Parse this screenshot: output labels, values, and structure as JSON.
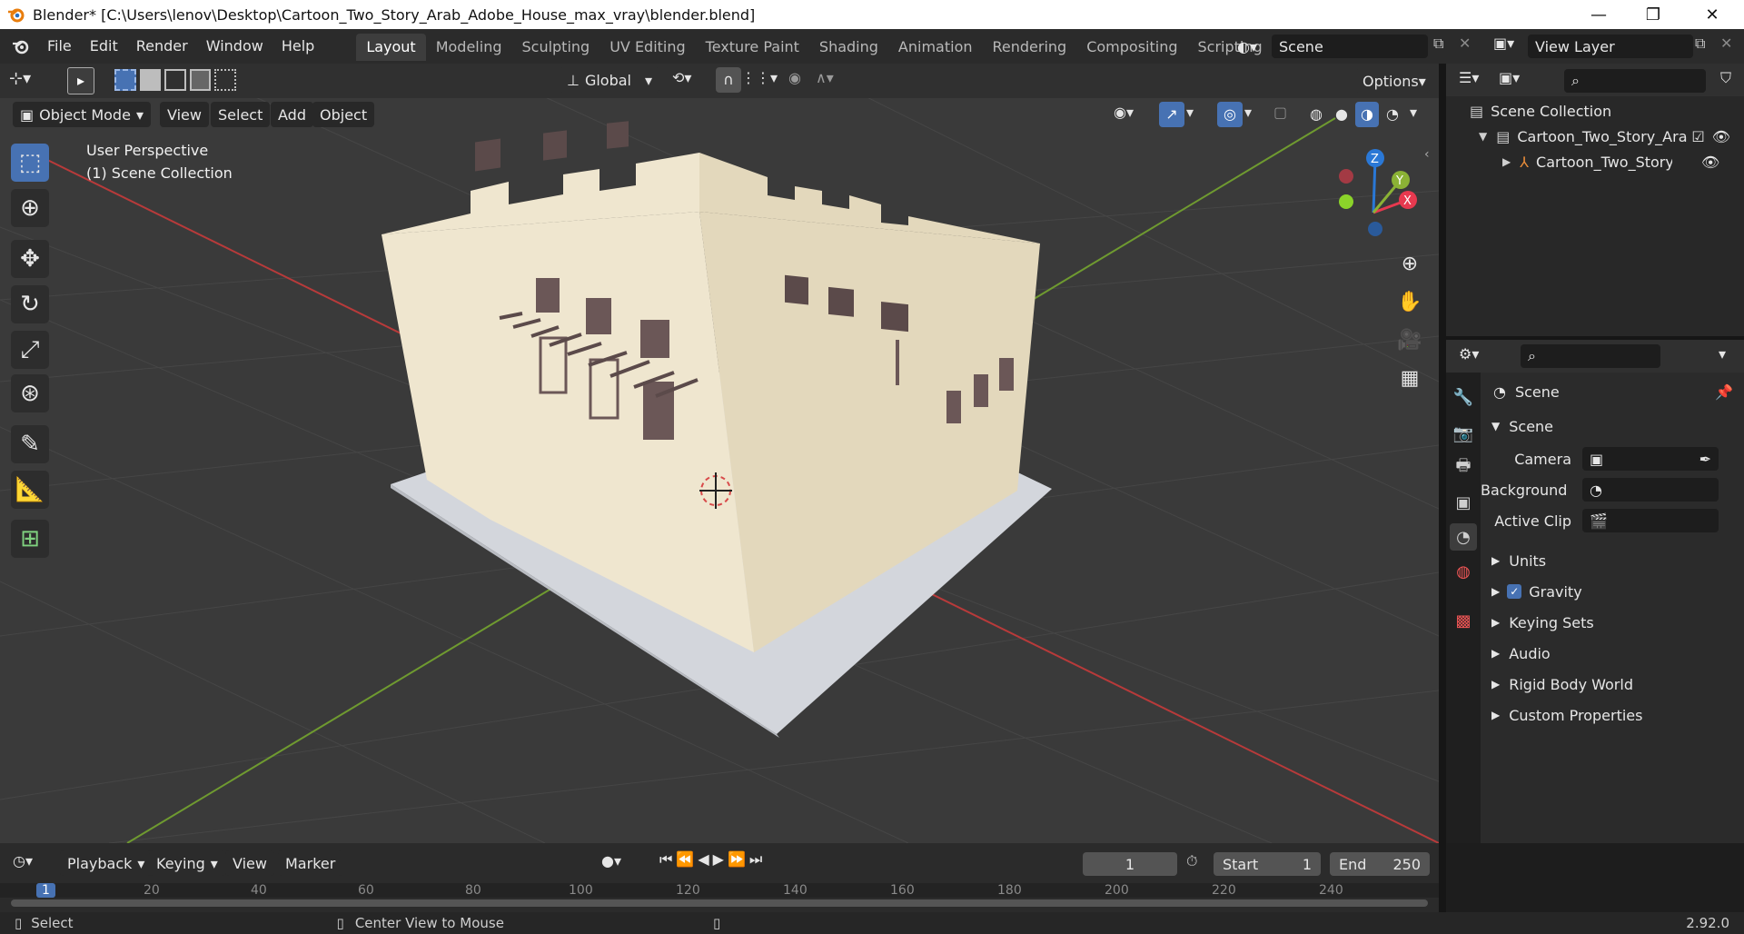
{
  "titlebar": {
    "title": "Blender* [C:\\Users\\lenov\\Desktop\\Cartoon_Two_Story_Arab_Adobe_House_max_vray\\blender.blend]",
    "minimize": "—",
    "maximize": "❐",
    "close": "✕"
  },
  "menu": {
    "items": [
      "File",
      "Edit",
      "Render",
      "Window",
      "Help"
    ]
  },
  "workspaces": {
    "tabs": [
      "Layout",
      "Modeling",
      "Sculpting",
      "UV Editing",
      "Texture Paint",
      "Shading",
      "Animation",
      "Rendering",
      "Compositing",
      "Scripting"
    ],
    "add_label": "+"
  },
  "scene_selector": {
    "value": "Scene"
  },
  "view_layer_selector": {
    "value": "View Layer"
  },
  "viewport_header": {
    "transform_orientation": "Global",
    "options_label": "Options",
    "mode": "Object Mode",
    "menus": [
      "View",
      "Select",
      "Add",
      "Object"
    ]
  },
  "viewport": {
    "perspective_label": "User Perspective",
    "collection_label": "(1) Scene Collection",
    "gizmo": {
      "x": "X",
      "y": "Y",
      "z": "Z"
    }
  },
  "outliner": {
    "rows": [
      {
        "label": "Scene Collection"
      },
      {
        "label": "Cartoon_Two_Story_Arab"
      },
      {
        "label": "Cartoon_Two_Story_/"
      }
    ]
  },
  "properties": {
    "context_label": "Scene",
    "panel_title": "Scene",
    "camera_label": "Camera",
    "background_label": "Background ...",
    "active_clip_label": "Active Clip",
    "sections": [
      "Units",
      "Gravity",
      "Keying Sets",
      "Audio",
      "Rigid Body World",
      "Custom Properties"
    ],
    "gravity_checked": true
  },
  "timeline": {
    "menus": [
      "Playback",
      "Keying",
      "View",
      "Marker"
    ],
    "current_frame": "1",
    "start_label": "Start",
    "start_value": "1",
    "end_label": "End",
    "end_value": "250",
    "ruler": [
      "1",
      "20",
      "40",
      "60",
      "80",
      "100",
      "120",
      "140",
      "160",
      "180",
      "200",
      "220",
      "240"
    ]
  },
  "statusbar": {
    "select_label": "Select",
    "center_label": "Center View to Mouse",
    "version": "2.92.0"
  },
  "colors": {
    "accent": "#4772b3",
    "x_axis": "#e7394f",
    "y_axis": "#8bb235",
    "z_axis": "#2a78d6",
    "wall": "#efe6cf",
    "ground": "#d3d6dc"
  }
}
